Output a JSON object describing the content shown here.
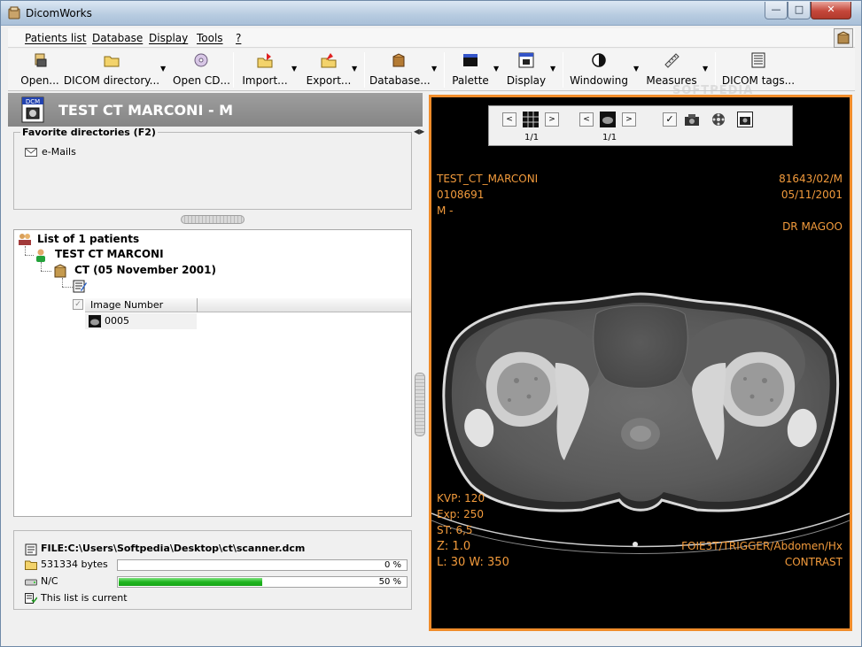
{
  "window": {
    "title": "DicomWorks",
    "controls": {
      "minimize": "—",
      "maximize": "□",
      "close": "✕"
    }
  },
  "menu": {
    "items": [
      "Patients list",
      "Database",
      "Display",
      "Tools",
      "?"
    ]
  },
  "toolbar": {
    "buttons": [
      "Open...",
      "DICOM directory...",
      "Open CD...",
      "Import...",
      "Export...",
      "Database...",
      "Palette",
      "Display",
      "Windowing",
      "Measures",
      "DICOM tags..."
    ]
  },
  "patient_header": {
    "name": "TEST CT MARCONI - M",
    "icon": "dcm-icon",
    "icon_text": "DCM"
  },
  "favorites": {
    "legend": "Favorite directories (F2)",
    "items": [
      "e-Mails"
    ]
  },
  "tree": {
    "root": "List of 1 patients",
    "patient": "TEST CT MARCONI",
    "study": "CT (05 November 2001)",
    "column_header": "Image Number",
    "row_value": "0005"
  },
  "status": {
    "file": "FILE:C:\\Users\\Softpedia\\Desktop\\ct\\scanner.dcm",
    "bytes": "531334 bytes",
    "bytes_progress": 0,
    "bytes_pct": "0 %",
    "nc": "N/C",
    "nc_progress": 50,
    "nc_pct": "50 %",
    "list_status": "This list is current"
  },
  "viewer": {
    "series_frac": "1/1",
    "image_frac": "1/1",
    "overlay": {
      "name": "TEST_CT_MARCONI",
      "id": "0108691",
      "sex": "M -",
      "study_id": "81643/02/M",
      "date": "05/11/2001",
      "doctor": "DR MAGOO",
      "kvp": "KVP: 120",
      "exp": "Exp: 250",
      "st": "ST: 6,5",
      "zoom": "Z: 1.0",
      "window": "L: 30 W: 350",
      "protocol": "FOIE3T/TRIGGER/Abdomen/Hx",
      "contrast": "CONTRAST"
    },
    "accent": "#f08c2a",
    "overlay_color": "#f39b3c"
  },
  "watermark": "SOFTPEDIA"
}
